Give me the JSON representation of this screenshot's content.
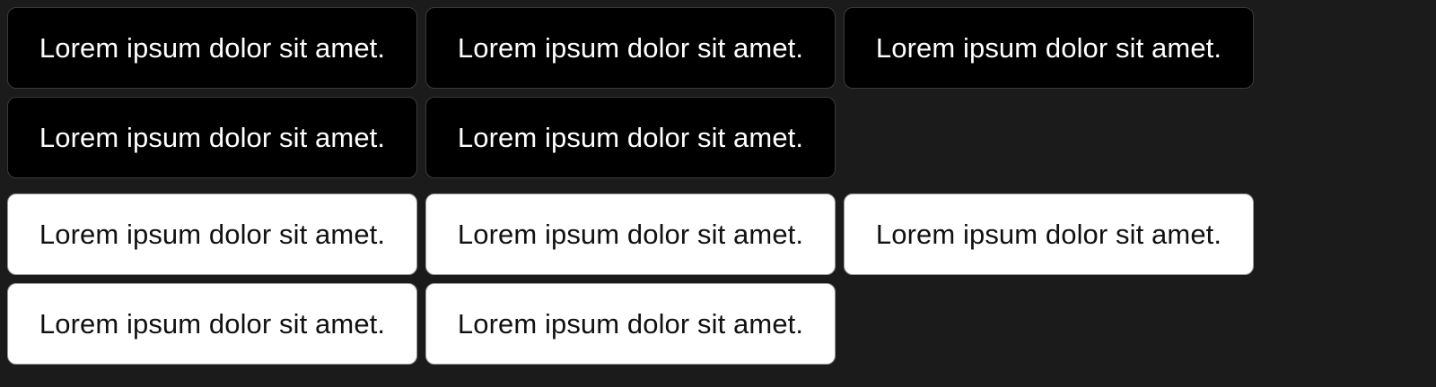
{
  "colors": {
    "background": "#1b1b1b",
    "dark_chip_bg": "#000000",
    "dark_chip_text": "#ffffff",
    "light_chip_bg": "#ffffff",
    "light_chip_text": "#111111"
  },
  "dark_chips": [
    {
      "label": "Lorem ipsum dolor sit amet."
    },
    {
      "label": "Lorem ipsum dolor sit amet."
    },
    {
      "label": "Lorem ipsum dolor sit amet."
    },
    {
      "label": "Lorem ipsum dolor sit amet."
    },
    {
      "label": "Lorem ipsum dolor sit amet."
    }
  ],
  "light_chips": [
    {
      "label": "Lorem ipsum dolor sit amet."
    },
    {
      "label": "Lorem ipsum dolor sit amet."
    },
    {
      "label": "Lorem ipsum dolor sit amet."
    },
    {
      "label": "Lorem ipsum dolor sit amet."
    },
    {
      "label": "Lorem ipsum dolor sit amet."
    }
  ]
}
